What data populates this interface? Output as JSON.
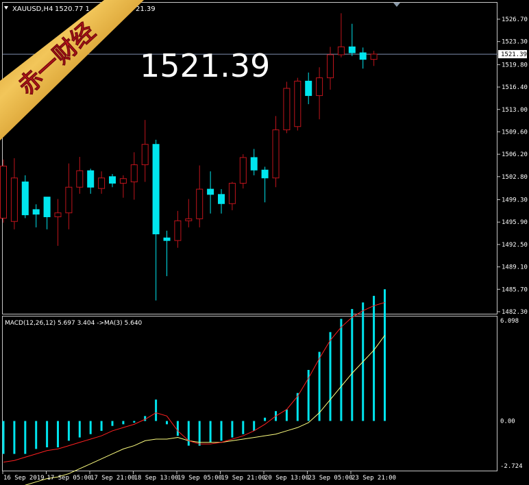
{
  "window": {
    "symbol": "XAUUSD,H4",
    "ohlc_text": "1520.77 1",
    "ohlc_tail": "21.39"
  },
  "watermark": {
    "text": "赤一财经"
  },
  "big_price": "1521.39",
  "main_chart": {
    "price_axis_labels": [
      "1526.70",
      "1523.30",
      "1519.80",
      "1516.40",
      "1513.00",
      "1509.60",
      "1506.20",
      "1502.80",
      "1499.30",
      "1495.90",
      "1492.50",
      "1489.10",
      "1485.70",
      "1482.30"
    ],
    "current_price_label": "1521.39",
    "current_price": 1521.39
  },
  "macd_panel": {
    "label": "MACD(12,26,12) 5.697 3.404  ->MA(3) 5.640",
    "axis_labels": [
      "6.098",
      "0.00",
      "-2.724"
    ],
    "ymax": 6.098,
    "ymin": -2.724
  },
  "time_axis": {
    "labels": [
      "16 Sep 2019",
      "17 Sep 05:00",
      "17 Sep 21:00",
      "18 Sep 13:00",
      "19 Sep 05:00",
      "19 Sep 21:00",
      "20 Sep 13:00",
      "23 Sep 05:00",
      "23 Sep 21:00"
    ]
  },
  "colors": {
    "bull": "#c0141c",
    "bear": "#00e5ee",
    "grid": "#c8c8c8",
    "macd_bar": "#00e5ee",
    "signal": "#ffff80",
    "ma3": "#ff2020",
    "price_line": "#8090b0"
  },
  "chart_data": {
    "type": "candlestick",
    "candles": [
      {
        "o": 1496.5,
        "h": 1505.4,
        "l": 1495.8,
        "c": 1504.4
      },
      {
        "o": 1496.0,
        "h": 1505.6,
        "l": 1494.8,
        "c": 1502.6
      },
      {
        "o": 1502.0,
        "h": 1503.0,
        "l": 1496.5,
        "c": 1497.0
      },
      {
        "o": 1497.8,
        "h": 1498.6,
        "l": 1495.1,
        "c": 1497.1
      },
      {
        "o": 1499.7,
        "h": 1499.7,
        "l": 1494.8,
        "c": 1496.7
      },
      {
        "o": 1496.7,
        "h": 1499.4,
        "l": 1492.3,
        "c": 1497.3
      },
      {
        "o": 1497.3,
        "h": 1504.8,
        "l": 1494.8,
        "c": 1501.2
      },
      {
        "o": 1501.2,
        "h": 1505.8,
        "l": 1500.2,
        "c": 1503.7
      },
      {
        "o": 1503.7,
        "h": 1504.0,
        "l": 1500.2,
        "c": 1501.2
      },
      {
        "o": 1501.0,
        "h": 1503.6,
        "l": 1500.2,
        "c": 1502.6
      },
      {
        "o": 1502.8,
        "h": 1503.2,
        "l": 1501.2,
        "c": 1501.8
      },
      {
        "o": 1501.8,
        "h": 1503.0,
        "l": 1499.6,
        "c": 1502.5
      },
      {
        "o": 1502.0,
        "h": 1506.5,
        "l": 1499.3,
        "c": 1504.6
      },
      {
        "o": 1504.6,
        "h": 1511.4,
        "l": 1502.0,
        "c": 1507.7
      },
      {
        "o": 1507.7,
        "h": 1508.4,
        "l": 1484.0,
        "c": 1494.1
      },
      {
        "o": 1493.5,
        "h": 1494.6,
        "l": 1487.7,
        "c": 1493.1
      },
      {
        "o": 1493.1,
        "h": 1497.6,
        "l": 1492.0,
        "c": 1496.1
      },
      {
        "o": 1496.1,
        "h": 1499.4,
        "l": 1495.1,
        "c": 1496.4
      },
      {
        "o": 1496.4,
        "h": 1504.5,
        "l": 1495.1,
        "c": 1500.9
      },
      {
        "o": 1500.9,
        "h": 1503.6,
        "l": 1497.2,
        "c": 1500.1
      },
      {
        "o": 1500.1,
        "h": 1500.9,
        "l": 1497.2,
        "c": 1498.7
      },
      {
        "o": 1498.7,
        "h": 1502.0,
        "l": 1497.7,
        "c": 1501.8
      },
      {
        "o": 1501.8,
        "h": 1506.2,
        "l": 1501.0,
        "c": 1505.7
      },
      {
        "o": 1505.7,
        "h": 1507.0,
        "l": 1503.0,
        "c": 1503.8
      },
      {
        "o": 1503.8,
        "h": 1504.3,
        "l": 1498.9,
        "c": 1502.6
      },
      {
        "o": 1502.6,
        "h": 1512.0,
        "l": 1501.2,
        "c": 1509.9
      },
      {
        "o": 1509.9,
        "h": 1517.2,
        "l": 1509.4,
        "c": 1516.2
      },
      {
        "o": 1510.4,
        "h": 1517.8,
        "l": 1509.8,
        "c": 1517.3
      },
      {
        "o": 1517.3,
        "h": 1518.6,
        "l": 1513.8,
        "c": 1515.1
      },
      {
        "o": 1515.1,
        "h": 1519.4,
        "l": 1511.5,
        "c": 1517.8
      },
      {
        "o": 1517.8,
        "h": 1522.5,
        "l": 1516.0,
        "c": 1521.3
      },
      {
        "o": 1521.3,
        "h": 1527.6,
        "l": 1520.9,
        "c": 1522.5
      },
      {
        "o": 1522.5,
        "h": 1526.0,
        "l": 1521.1,
        "c": 1521.6
      },
      {
        "o": 1521.6,
        "h": 1522.4,
        "l": 1519.2,
        "c": 1520.6
      },
      {
        "o": 1520.6,
        "h": 1521.9,
        "l": 1519.6,
        "c": 1521.4
      }
    ],
    "macd_hist": [
      -2.0,
      -2.0,
      -2.0,
      -1.7,
      -1.6,
      -1.6,
      -1.2,
      -1.0,
      -0.8,
      -0.6,
      -0.3,
      -0.2,
      -0.1,
      0.3,
      1.3,
      -0.2,
      -0.9,
      -1.5,
      -1.5,
      -1.3,
      -1.2,
      -1.0,
      -0.8,
      -0.6,
      0.2,
      0.6,
      0.7,
      1.7,
      3.1,
      4.2,
      5.4,
      6.2,
      6.8,
      7.2,
      7.6,
      8.0
    ],
    "signal_line": [
      -4.4,
      -4.2,
      -3.9,
      -3.7,
      -3.5,
      -3.4,
      -3.2,
      -2.9,
      -2.6,
      -2.3,
      -2.0,
      -1.7,
      -1.5,
      -1.2,
      -1.1,
      -1.1,
      -1.0,
      -1.2,
      -1.3,
      -1.3,
      -1.3,
      -1.2,
      -1.1,
      -1.0,
      -0.9,
      -0.8,
      -0.6,
      -0.4,
      -0.1,
      0.5,
      1.3,
      2.1,
      2.9,
      3.6,
      4.3,
      5.2
    ],
    "ma3_line": [
      -2.5,
      -2.4,
      -2.2,
      -2.0,
      -1.8,
      -1.7,
      -1.5,
      -1.3,
      -1.1,
      -0.9,
      -0.6,
      -0.4,
      -0.2,
      0.1,
      0.5,
      0.3,
      -0.6,
      -1.2,
      -1.4,
      -1.4,
      -1.3,
      -1.1,
      -0.9,
      -0.6,
      -0.2,
      0.3,
      0.7,
      1.5,
      2.6,
      3.8,
      4.9,
      5.7,
      6.3,
      6.7,
      7.0,
      7.2
    ]
  }
}
